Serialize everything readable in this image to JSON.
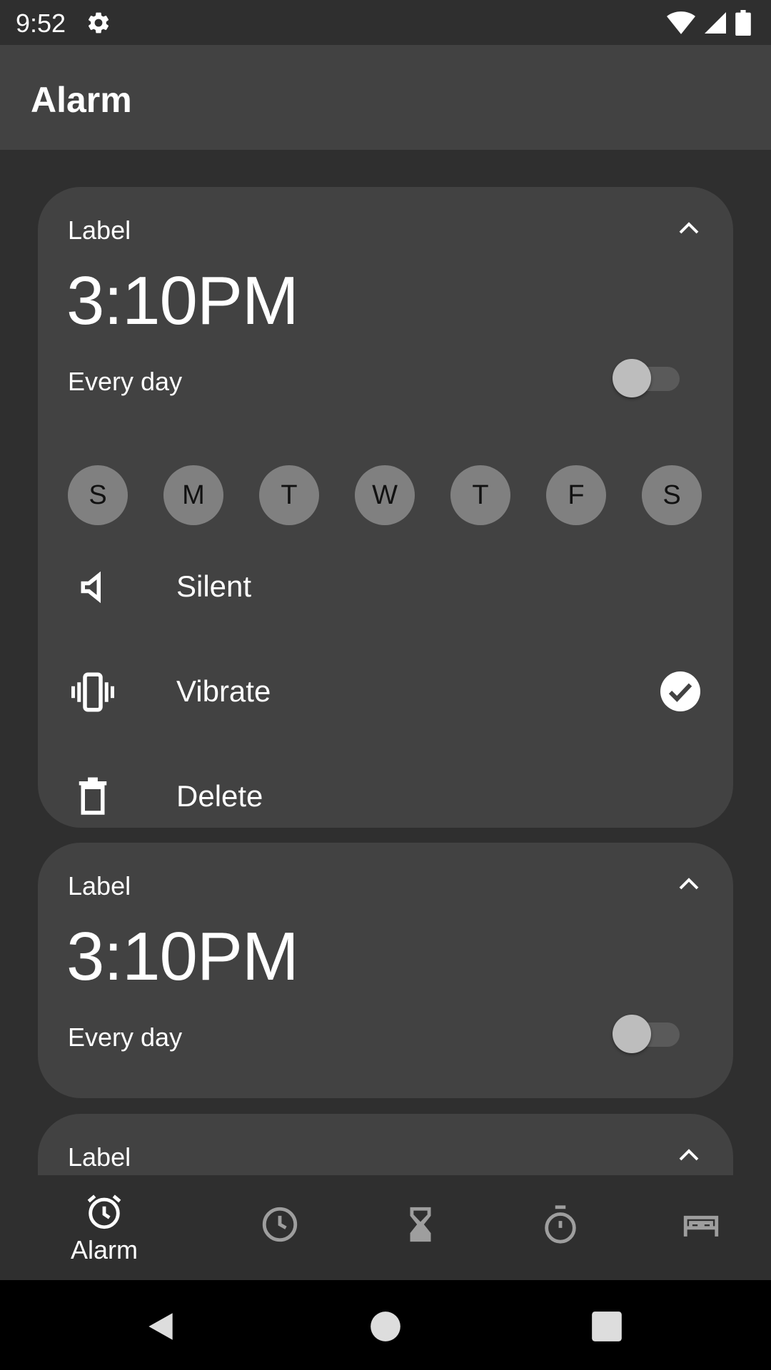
{
  "status_bar": {
    "time": "9:52",
    "icons": [
      "settings-icon",
      "wifi-icon",
      "signal-icon",
      "battery-icon"
    ]
  },
  "app_bar": {
    "title": "Alarm"
  },
  "alarms": [
    {
      "label": "Label",
      "time": "3:10PM",
      "repeat": "Every day",
      "enabled": false,
      "expanded": true,
      "days": [
        "S",
        "M",
        "T",
        "W",
        "T",
        "F",
        "S"
      ],
      "options": [
        {
          "label": "Silent",
          "icon": "volume-off-icon",
          "checked": false
        },
        {
          "label": "Vibrate",
          "icon": "vibrate-icon",
          "checked": true
        },
        {
          "label": "Delete",
          "icon": "delete-icon",
          "checked": false
        }
      ]
    },
    {
      "label": "Label",
      "time": "3:10PM",
      "repeat": "Every day",
      "enabled": false,
      "expanded": false
    },
    {
      "label": "Label",
      "expanded": false
    }
  ],
  "bottom_nav": {
    "items": [
      {
        "label": "Alarm",
        "icon": "alarm-icon",
        "selected": true
      },
      {
        "label": "",
        "icon": "clock-icon",
        "selected": false
      },
      {
        "label": "",
        "icon": "hourglass-icon",
        "selected": false
      },
      {
        "label": "",
        "icon": "stopwatch-icon",
        "selected": false
      },
      {
        "label": "",
        "icon": "bed-icon",
        "selected": false
      }
    ]
  },
  "colors": {
    "background": "#2f2f2f",
    "surface": "#424242",
    "day_chip": "#808080",
    "toggle_thumb": "#bdbdbd",
    "text": "#ffffff"
  }
}
